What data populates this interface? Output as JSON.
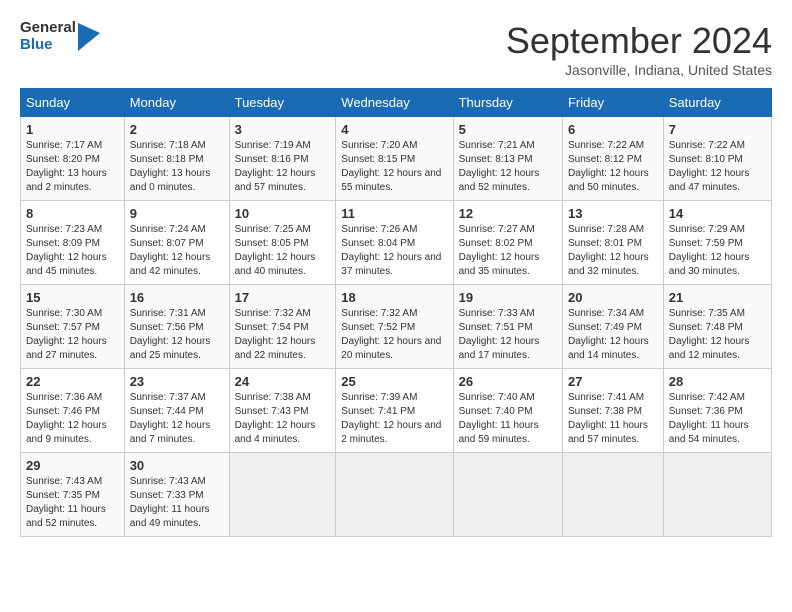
{
  "logo": {
    "line1": "General",
    "line2": "Blue"
  },
  "title": "September 2024",
  "subtitle": "Jasonville, Indiana, United States",
  "days_of_week": [
    "Sunday",
    "Monday",
    "Tuesday",
    "Wednesday",
    "Thursday",
    "Friday",
    "Saturday"
  ],
  "weeks": [
    [
      {
        "num": "1",
        "sunrise": "7:17 AM",
        "sunset": "8:20 PM",
        "daylight": "13 hours and 2 minutes."
      },
      {
        "num": "2",
        "sunrise": "7:18 AM",
        "sunset": "8:18 PM",
        "daylight": "13 hours and 0 minutes."
      },
      {
        "num": "3",
        "sunrise": "7:19 AM",
        "sunset": "8:16 PM",
        "daylight": "12 hours and 57 minutes."
      },
      {
        "num": "4",
        "sunrise": "7:20 AM",
        "sunset": "8:15 PM",
        "daylight": "12 hours and 55 minutes."
      },
      {
        "num": "5",
        "sunrise": "7:21 AM",
        "sunset": "8:13 PM",
        "daylight": "12 hours and 52 minutes."
      },
      {
        "num": "6",
        "sunrise": "7:22 AM",
        "sunset": "8:12 PM",
        "daylight": "12 hours and 50 minutes."
      },
      {
        "num": "7",
        "sunrise": "7:22 AM",
        "sunset": "8:10 PM",
        "daylight": "12 hours and 47 minutes."
      }
    ],
    [
      {
        "num": "8",
        "sunrise": "7:23 AM",
        "sunset": "8:09 PM",
        "daylight": "12 hours and 45 minutes."
      },
      {
        "num": "9",
        "sunrise": "7:24 AM",
        "sunset": "8:07 PM",
        "daylight": "12 hours and 42 minutes."
      },
      {
        "num": "10",
        "sunrise": "7:25 AM",
        "sunset": "8:05 PM",
        "daylight": "12 hours and 40 minutes."
      },
      {
        "num": "11",
        "sunrise": "7:26 AM",
        "sunset": "8:04 PM",
        "daylight": "12 hours and 37 minutes."
      },
      {
        "num": "12",
        "sunrise": "7:27 AM",
        "sunset": "8:02 PM",
        "daylight": "12 hours and 35 minutes."
      },
      {
        "num": "13",
        "sunrise": "7:28 AM",
        "sunset": "8:01 PM",
        "daylight": "12 hours and 32 minutes."
      },
      {
        "num": "14",
        "sunrise": "7:29 AM",
        "sunset": "7:59 PM",
        "daylight": "12 hours and 30 minutes."
      }
    ],
    [
      {
        "num": "15",
        "sunrise": "7:30 AM",
        "sunset": "7:57 PM",
        "daylight": "12 hours and 27 minutes."
      },
      {
        "num": "16",
        "sunrise": "7:31 AM",
        "sunset": "7:56 PM",
        "daylight": "12 hours and 25 minutes."
      },
      {
        "num": "17",
        "sunrise": "7:32 AM",
        "sunset": "7:54 PM",
        "daylight": "12 hours and 22 minutes."
      },
      {
        "num": "18",
        "sunrise": "7:32 AM",
        "sunset": "7:52 PM",
        "daylight": "12 hours and 20 minutes."
      },
      {
        "num": "19",
        "sunrise": "7:33 AM",
        "sunset": "7:51 PM",
        "daylight": "12 hours and 17 minutes."
      },
      {
        "num": "20",
        "sunrise": "7:34 AM",
        "sunset": "7:49 PM",
        "daylight": "12 hours and 14 minutes."
      },
      {
        "num": "21",
        "sunrise": "7:35 AM",
        "sunset": "7:48 PM",
        "daylight": "12 hours and 12 minutes."
      }
    ],
    [
      {
        "num": "22",
        "sunrise": "7:36 AM",
        "sunset": "7:46 PM",
        "daylight": "12 hours and 9 minutes."
      },
      {
        "num": "23",
        "sunrise": "7:37 AM",
        "sunset": "7:44 PM",
        "daylight": "12 hours and 7 minutes."
      },
      {
        "num": "24",
        "sunrise": "7:38 AM",
        "sunset": "7:43 PM",
        "daylight": "12 hours and 4 minutes."
      },
      {
        "num": "25",
        "sunrise": "7:39 AM",
        "sunset": "7:41 PM",
        "daylight": "12 hours and 2 minutes."
      },
      {
        "num": "26",
        "sunrise": "7:40 AM",
        "sunset": "7:40 PM",
        "daylight": "11 hours and 59 minutes."
      },
      {
        "num": "27",
        "sunrise": "7:41 AM",
        "sunset": "7:38 PM",
        "daylight": "11 hours and 57 minutes."
      },
      {
        "num": "28",
        "sunrise": "7:42 AM",
        "sunset": "7:36 PM",
        "daylight": "11 hours and 54 minutes."
      }
    ],
    [
      {
        "num": "29",
        "sunrise": "7:43 AM",
        "sunset": "7:35 PM",
        "daylight": "11 hours and 52 minutes."
      },
      {
        "num": "30",
        "sunrise": "7:43 AM",
        "sunset": "7:33 PM",
        "daylight": "11 hours and 49 minutes."
      },
      null,
      null,
      null,
      null,
      null
    ]
  ],
  "labels": {
    "sunrise": "Sunrise:",
    "sunset": "Sunset:",
    "daylight": "Daylight:"
  }
}
